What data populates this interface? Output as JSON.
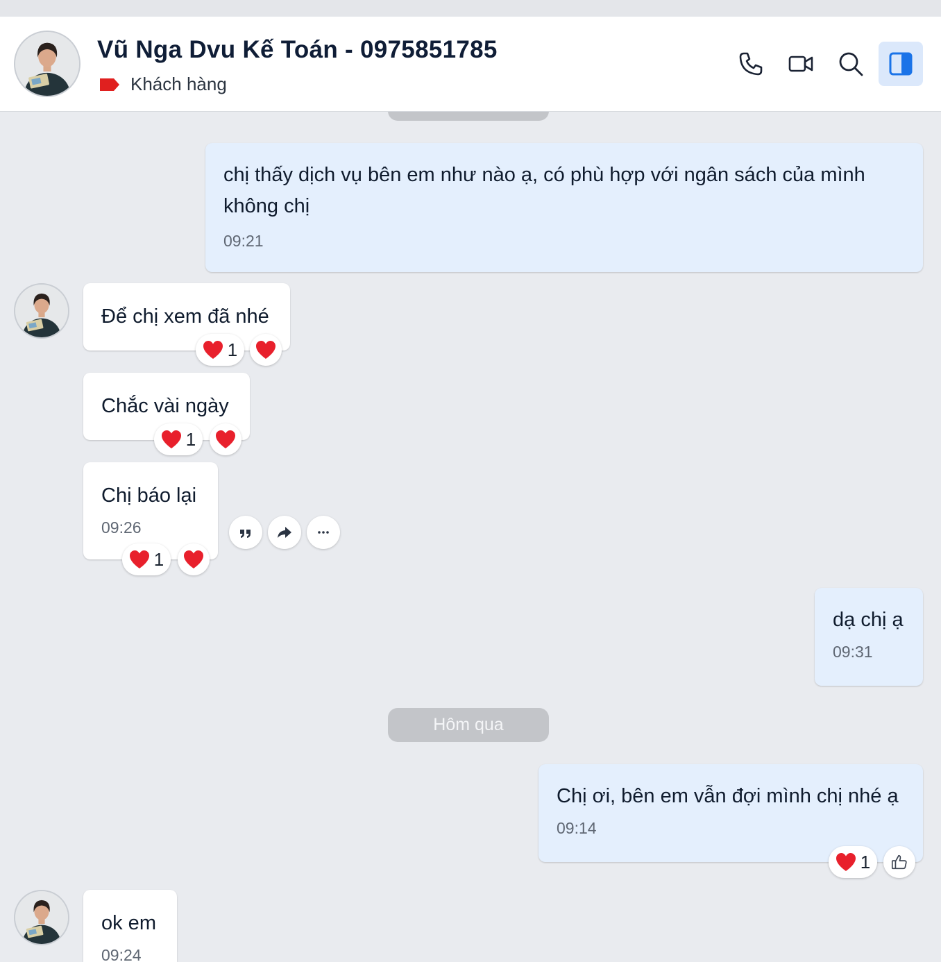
{
  "header": {
    "contact_name": "Vũ Nga Dvu Kế Toán - 0975851785",
    "tag_label": "Khách hàng",
    "tag_color": "#e0201f",
    "icons": [
      "phone-icon",
      "video-call-icon",
      "search-icon",
      "sidebar-panel-icon"
    ],
    "accent": "#1a73e8"
  },
  "messages": [
    {
      "direction": "out",
      "text": "chị thấy dịch vụ bên em như nào ạ, có phù hợp với ngân sách của mình không chị",
      "time": "09:21"
    },
    {
      "direction": "in",
      "text": "Để chị xem đã nhé",
      "reaction_count": "1"
    },
    {
      "direction": "in",
      "text": "Chắc vài ngày",
      "reaction_count": "1"
    },
    {
      "direction": "in",
      "text": "Chị báo lại",
      "time": "09:26",
      "reaction_count": "1"
    },
    {
      "direction": "out",
      "text": "dạ chị ạ",
      "time": "09:31"
    },
    {
      "direction": "out",
      "text": "Chị ơi, bên em vẫn đợi mình chị nhé ạ",
      "time": "09:14",
      "reaction_count": "1"
    },
    {
      "direction": "in",
      "text": "ok em",
      "time": "09:24"
    }
  ],
  "date_separator": "Hôm qua",
  "message_actions": [
    "quote-icon",
    "forward-icon",
    "more-icon"
  ]
}
